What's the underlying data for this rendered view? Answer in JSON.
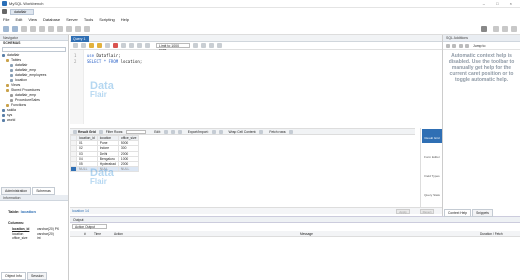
{
  "window": {
    "title": "MySQL Workbench",
    "controls": [
      "–",
      "□",
      "×"
    ]
  },
  "connection_tab": {
    "label": "dataflair"
  },
  "menu": [
    "File",
    "Edit",
    "View",
    "Database",
    "Server",
    "Tools",
    "Scripting",
    "Help"
  ],
  "navigator": {
    "header": "Navigator",
    "section": "SCHEMAS",
    "tree": [
      {
        "label": "dataflair",
        "level": 0,
        "kind": "db"
      },
      {
        "label": "Tables",
        "level": 1,
        "kind": "folder"
      },
      {
        "label": "dataflair",
        "level": 2,
        "kind": "table"
      },
      {
        "label": "dataflair_emp",
        "level": 2,
        "kind": "table"
      },
      {
        "label": "dataflair_employees",
        "level": 2,
        "kind": "table"
      },
      {
        "label": "location",
        "level": 2,
        "kind": "table"
      },
      {
        "label": "Views",
        "level": 1,
        "kind": "folder"
      },
      {
        "label": "Stored Procedures",
        "level": 1,
        "kind": "folder"
      },
      {
        "label": "dataflair_emp",
        "level": 2,
        "kind": "proc"
      },
      {
        "label": "ProcedureSales",
        "level": 2,
        "kind": "proc"
      },
      {
        "label": "Functions",
        "level": 1,
        "kind": "folder"
      },
      {
        "label": "sakila",
        "level": 0,
        "kind": "db"
      },
      {
        "label": "sys",
        "level": 0,
        "kind": "db"
      },
      {
        "label": "world",
        "level": 0,
        "kind": "db"
      }
    ],
    "bottom_tabs": [
      "Administration",
      "Schemas"
    ]
  },
  "information": {
    "header": "Information",
    "table_label": "Table:",
    "table_name": "location",
    "columns_label": "Columns:",
    "columns": [
      {
        "name": "location_id",
        "type": "varchar(20) PK"
      },
      {
        "name": "location",
        "type": "varchar(20)"
      },
      {
        "name": "office_size",
        "type": "int"
      }
    ],
    "bottom_tabs": [
      "Object Info",
      "Session"
    ]
  },
  "query_tab": {
    "label": "Query 1"
  },
  "limit_select": {
    "value": "Limit to 1000 rows"
  },
  "editor": {
    "lines": [
      {
        "num": "1",
        "kw": "use",
        "rest": " Dataflair;"
      },
      {
        "num": "2",
        "kw": "SELECT * FROM",
        "rest": " location;"
      }
    ]
  },
  "watermark": {
    "big": "Data",
    "small": "Flair"
  },
  "result_toolbar": {
    "label": "Result Grid",
    "filter": "Filter Rows:",
    "edit": "Edit:",
    "export": "Export/Import:",
    "wrap": "Wrap Cell Content:",
    "fetch": "Fetch rows:"
  },
  "result": {
    "columns": [
      "location_id",
      "location",
      "office_size"
    ],
    "rows": [
      [
        "01",
        "Pune",
        "5000"
      ],
      [
        "02",
        "Indore",
        "300"
      ],
      [
        "03",
        "Delhi",
        "2000"
      ],
      [
        "04",
        "Bengaluru",
        "1000"
      ],
      [
        "05",
        "Hyderabad",
        "2000"
      ],
      [
        "NULL",
        "NULL",
        "NULL"
      ]
    ]
  },
  "result_sidebar": [
    {
      "label": "Result Grid",
      "active": true
    },
    {
      "label": "Form Editor",
      "active": false
    },
    {
      "label": "Field Types",
      "active": false
    },
    {
      "label": "Query Stats",
      "active": false
    }
  ],
  "result_bar": {
    "tab": "location 14",
    "apply": "Apply",
    "revert": "Revert"
  },
  "output": {
    "header": "Output",
    "selector": "Action Output",
    "columns": [
      "#",
      "Time",
      "Action",
      "Message",
      "Duration / Fetch"
    ]
  },
  "sql_additions": {
    "header": "SQL Additions",
    "jump_label": "Jump to",
    "help_text": "Automatic context help is disabled. Use the toolbar to manually get help for the current caret position or to toggle automatic help.",
    "bottom_tabs": [
      "Context Help",
      "Snippets"
    ]
  },
  "colors": {
    "accent": "#2f6fb4",
    "watermark": "#2f8fd9",
    "keyword": "#2e64c8"
  }
}
